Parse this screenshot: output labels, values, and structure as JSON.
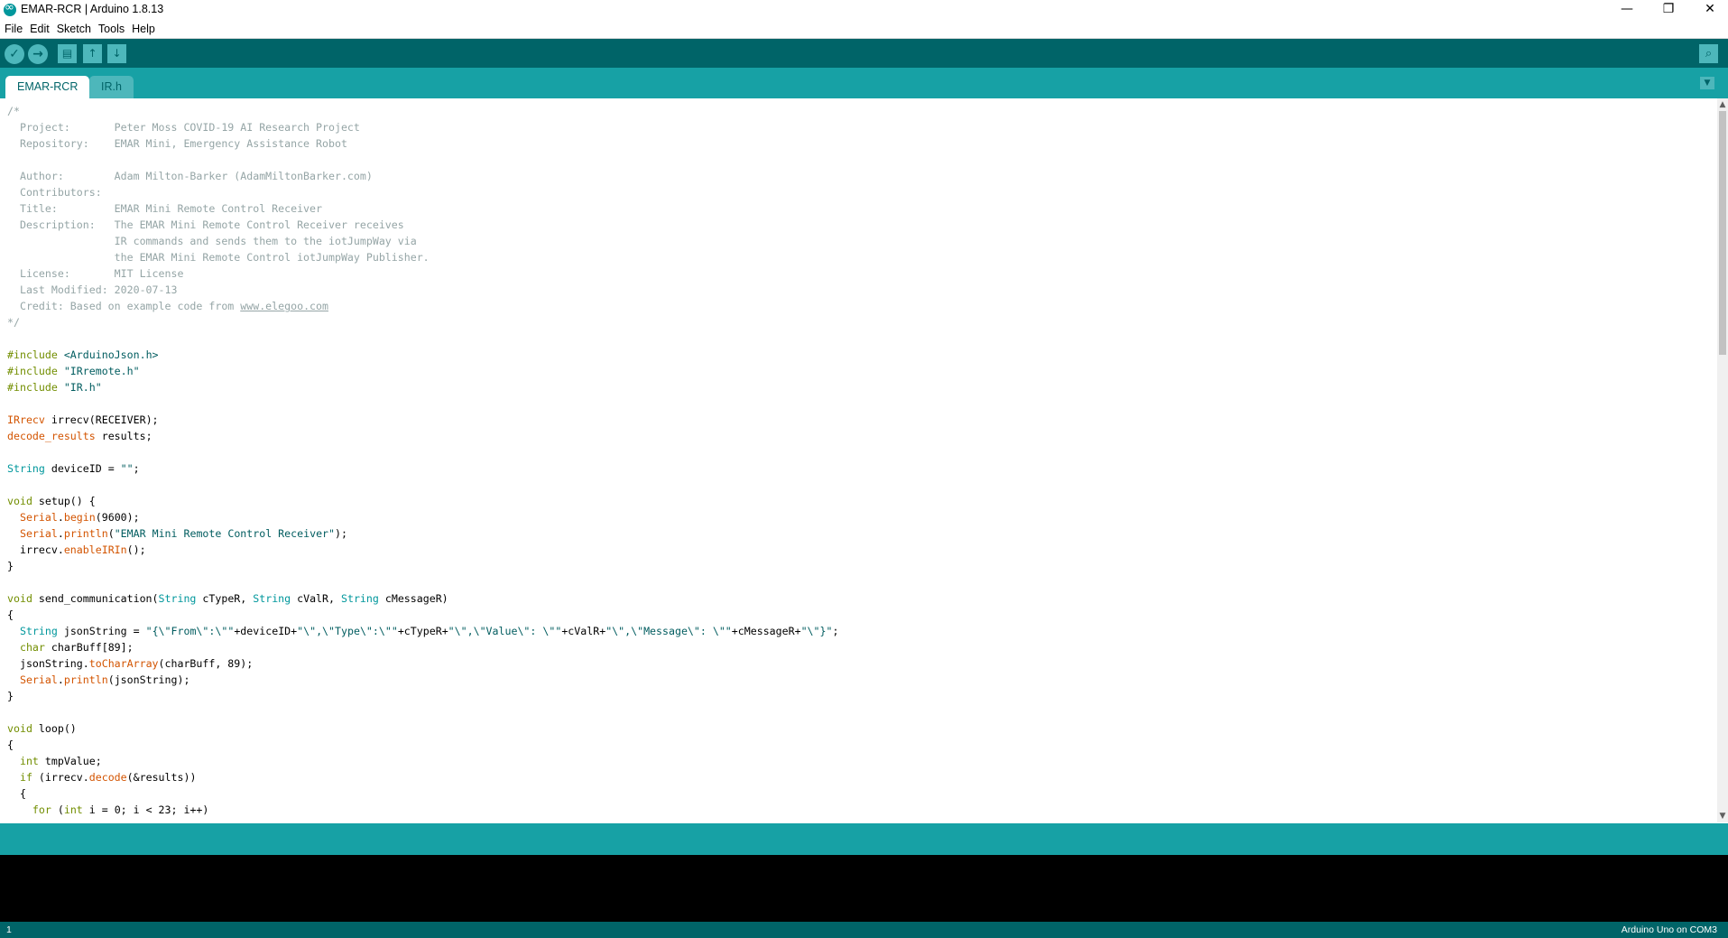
{
  "window": {
    "title": "EMAR-RCR | Arduino 1.8.13",
    "minimize": "—",
    "maximize": "❐",
    "close": "✕"
  },
  "menu": [
    "File",
    "Edit",
    "Sketch",
    "Tools",
    "Help"
  ],
  "toolbar": {
    "verify_icon": "✓",
    "upload_icon": "→",
    "new_icon": "▤",
    "open_icon": "↑",
    "save_icon": "↓",
    "serial_monitor_icon": "⌕"
  },
  "tabs": [
    {
      "label": "EMAR-RCR",
      "active": true
    },
    {
      "label": "IR.h",
      "active": false
    }
  ],
  "tab_menu_icon": "▼",
  "code_lines": [
    "/*",
    "  Project:       Peter Moss COVID-19 AI Research Project",
    "  Repository:    EMAR Mini, Emergency Assistance Robot",
    "",
    "  Author:        Adam Milton-Barker (AdamMiltonBarker.com)",
    "  Contributors:",
    "  Title:         EMAR Mini Remote Control Receiver",
    "  Description:   The EMAR Mini Remote Control Receiver receives",
    "                 IR commands and sends them to the iotJumpWay via",
    "                 the EMAR Mini Remote Control iotJumpWay Publisher.",
    "  License:       MIT License",
    "  Last Modified: 2020-07-13",
    "  Credit: Based on example code from www.elegoo.com",
    "*/",
    "",
    "#include <ArduinoJson.h>",
    "#include \"IRremote.h\"",
    "#include \"IR.h\"",
    "",
    "IRrecv irrecv(RECEIVER);",
    "decode_results results;",
    "",
    "String deviceID = \"\";",
    "",
    "void setup() {",
    "  Serial.begin(9600);",
    "  Serial.println(\"EMAR Mini Remote Control Receiver\");",
    "  irrecv.enableIRIn();",
    "}",
    "",
    "void send_communication(String cTypeR, String cValR, String cMessageR)",
    "{",
    "  String jsonString = \"{\\\"From\\\":\\\"\"+deviceID+\"\\\",\\\"Type\\\":\\\"\"+cTypeR+\"\\\",\\\"Value\\\": \\\"\"+cValR+\"\\\",\\\"Message\\\": \\\"\"+cMessageR+\"\\\"}\";",
    "  char charBuff[89];",
    "  jsonString.toCharArray(charBuff, 89);",
    "  Serial.println(jsonString);",
    "}",
    "",
    "void loop()",
    "{",
    "  int tmpValue;",
    "  if (irrecv.decode(&results))",
    "  {",
    "    for (int i = 0; i < 23; i++)"
  ],
  "status": {
    "line_number": "1",
    "board": "Arduino Uno on COM3"
  },
  "colors": {
    "toolbar": "#006468",
    "tabbar": "#17a1a5",
    "comment": "#95a5a6",
    "keyword": "#728e00",
    "type": "#00979c",
    "function": "#d35400",
    "string": "#005c5f"
  }
}
